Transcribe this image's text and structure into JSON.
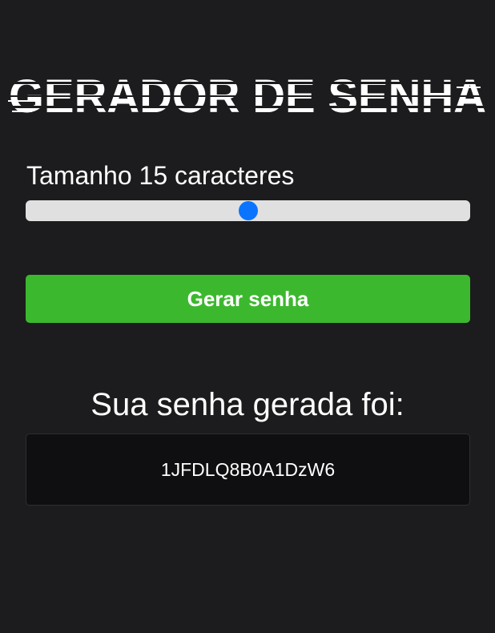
{
  "header": {
    "title": "GERADOR DE SENHA"
  },
  "length": {
    "label_prefix": "Tamanho",
    "value": "15",
    "label_suffix": "caracteres",
    "slider_level": 0.5
  },
  "actions": {
    "generate_label": "Gerar senha"
  },
  "result": {
    "title": "Sua senha gerada foi:",
    "password": "1JFDLQ8B0A1DzW6"
  },
  "colors": {
    "background": "#1c1c1e",
    "accent": "#3cb82e",
    "slider_thumb": "#0a74ff"
  }
}
